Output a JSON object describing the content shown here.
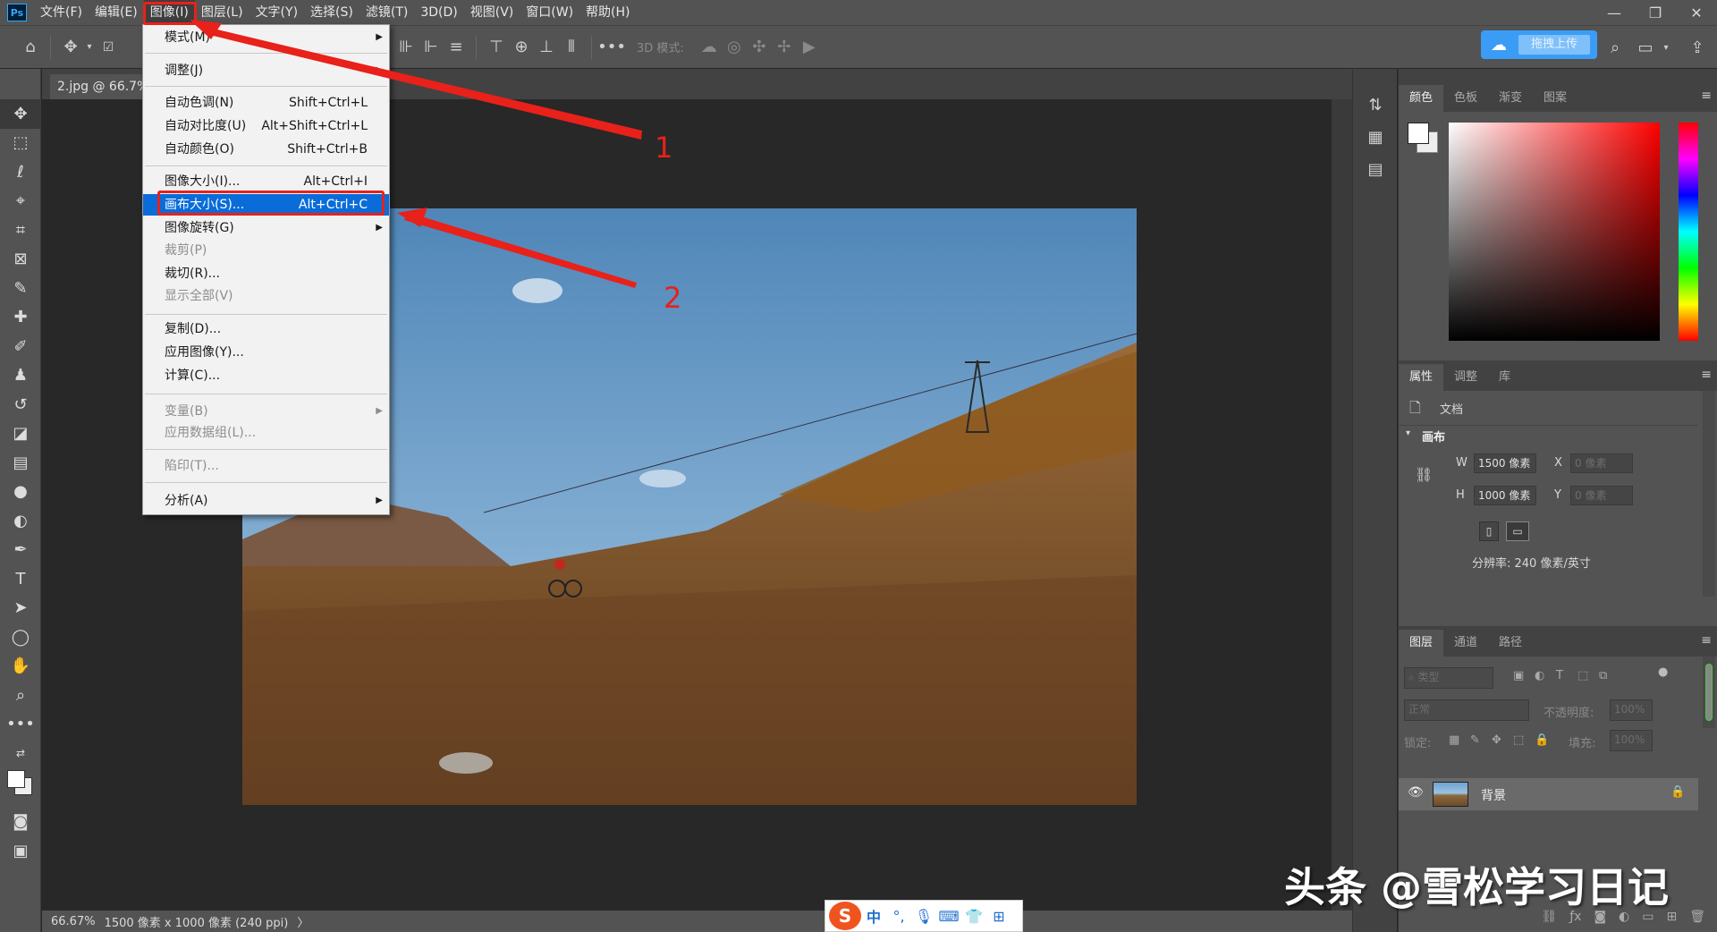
{
  "menubar": {
    "logo": "Ps",
    "items": [
      "文件(F)",
      "编辑(E)",
      "图像(I)",
      "图层(L)",
      "文字(Y)",
      "选择(S)",
      "滤镜(T)",
      "3D(D)",
      "视图(V)",
      "窗口(W)",
      "帮助(H)"
    ],
    "active_index": 2
  },
  "optbar": {
    "mode_label": "3D 模式:",
    "upload_label": "拖拽上传"
  },
  "document": {
    "tab_title": "2.jpg @ 66.7%"
  },
  "image_menu": {
    "items": [
      {
        "label": "模式(M)",
        "shortcut": "",
        "submenu": true,
        "disabled": false
      },
      {
        "label": "调整(J)",
        "shortcut": "",
        "submenu": true,
        "disabled": false
      },
      {
        "label": "自动色调(N)",
        "shortcut": "Shift+Ctrl+L",
        "submenu": false,
        "disabled": false
      },
      {
        "label": "自动对比度(U)",
        "shortcut": "Alt+Shift+Ctrl+L",
        "submenu": false,
        "disabled": false
      },
      {
        "label": "自动颜色(O)",
        "shortcut": "Shift+Ctrl+B",
        "submenu": false,
        "disabled": false
      },
      {
        "label": "图像大小(I)...",
        "shortcut": "Alt+Ctrl+I",
        "submenu": false,
        "disabled": false
      },
      {
        "label": "画布大小(S)...",
        "shortcut": "Alt+Ctrl+C",
        "submenu": false,
        "disabled": false,
        "highlighted": true
      },
      {
        "label": "图像旋转(G)",
        "shortcut": "",
        "submenu": true,
        "disabled": false
      },
      {
        "label": "裁剪(P)",
        "shortcut": "",
        "submenu": false,
        "disabled": true
      },
      {
        "label": "裁切(R)...",
        "shortcut": "",
        "submenu": false,
        "disabled": false
      },
      {
        "label": "显示全部(V)",
        "shortcut": "",
        "submenu": false,
        "disabled": true
      },
      {
        "label": "复制(D)...",
        "shortcut": "",
        "submenu": false,
        "disabled": false
      },
      {
        "label": "应用图像(Y)...",
        "shortcut": "",
        "submenu": false,
        "disabled": false
      },
      {
        "label": "计算(C)...",
        "shortcut": "",
        "submenu": false,
        "disabled": false
      },
      {
        "label": "变量(B)",
        "shortcut": "",
        "submenu": true,
        "disabled": true
      },
      {
        "label": "应用数据组(L)...",
        "shortcut": "",
        "submenu": false,
        "disabled": true
      },
      {
        "label": "陷印(T)...",
        "shortcut": "",
        "submenu": false,
        "disabled": true
      },
      {
        "label": "分析(A)",
        "shortcut": "",
        "submenu": true,
        "disabled": false
      }
    ]
  },
  "annotations": {
    "step1": "1",
    "step2": "2"
  },
  "statusbar": {
    "zoom": "66.67%",
    "doc_info": "1500 像素 x 1000 像素 (240 ppi)",
    "arrow": "〉"
  },
  "color_panel": {
    "tabs": [
      "颜色",
      "色板",
      "渐变",
      "图案"
    ],
    "foreground": "#ffffff",
    "background": "#eeeeee"
  },
  "properties_panel": {
    "tabs": [
      "属性",
      "调整",
      "库"
    ],
    "doc_label": "文档",
    "section": "画布",
    "w_label": "W",
    "w_value": "1500 像素",
    "h_label": "H",
    "h_value": "1000 像素",
    "x_label": "X",
    "x_value": "0 像素",
    "y_label": "Y",
    "y_value": "0 像素",
    "resolution": "分辨率: 240 像素/英寸"
  },
  "layers_panel": {
    "tabs": [
      "图层",
      "通道",
      "路径"
    ],
    "filter_label": "类型",
    "blend_mode": "正常",
    "opacity_label": "不透明度:",
    "opacity_value": "100%",
    "lock_label": "锁定:",
    "fill_label": "填充:",
    "fill_value": "100%",
    "layer_name": "背景"
  },
  "watermark": "头条 @雪松学习日记",
  "ime": {
    "logo": "S",
    "chinese": "中"
  },
  "colors": {
    "menu_highlight": "#0a6cd9",
    "annotation_red": "#e8211a",
    "upload_blue": "#3b9cf5"
  }
}
